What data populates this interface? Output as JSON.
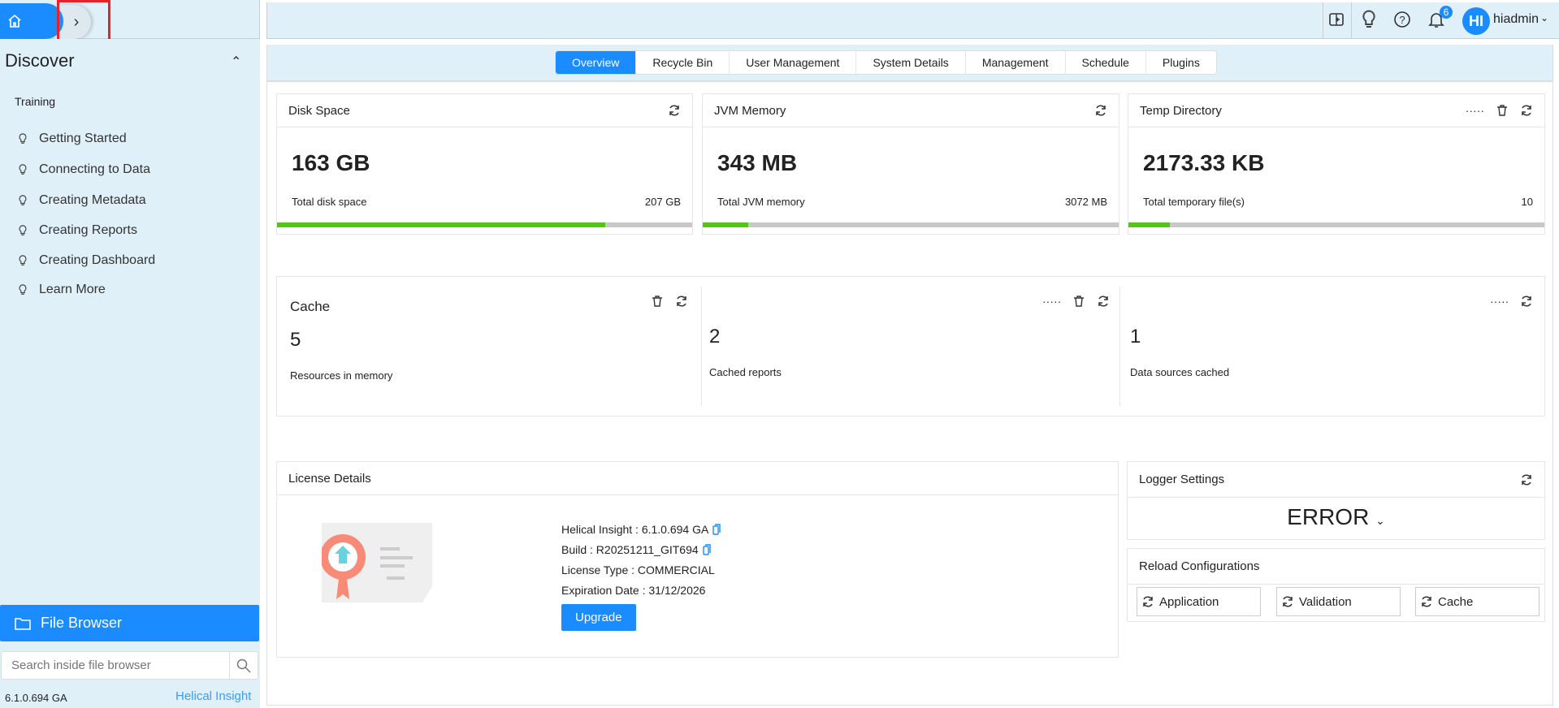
{
  "header": {
    "user_initials": "HI",
    "username": "hiadmin",
    "notification_count": "6"
  },
  "sidebar": {
    "title": "Discover",
    "section": "Training",
    "items": [
      {
        "label": "Getting Started"
      },
      {
        "label": "Connecting to Data"
      },
      {
        "label": "Creating Metadata"
      },
      {
        "label": "Creating Reports"
      },
      {
        "label": "Creating Dashboard"
      },
      {
        "label": "Learn More"
      }
    ],
    "file_browser": "File Browser",
    "search_placeholder": "Search inside file browser",
    "version": "6.1.0.694 GA",
    "brand": "Helical Insight"
  },
  "tabs": [
    {
      "label": "Overview",
      "active": true
    },
    {
      "label": "Recycle Bin"
    },
    {
      "label": "User Management"
    },
    {
      "label": "System Details"
    },
    {
      "label": "Management"
    },
    {
      "label": "Schedule"
    },
    {
      "label": "Plugins"
    }
  ],
  "cards": [
    {
      "title": "Disk Space",
      "value": "163 GB",
      "label": "Total disk space",
      "total": "207 GB",
      "progress": 0.79
    },
    {
      "title": "JVM Memory",
      "value": "343 MB",
      "label": "Total JVM memory",
      "total": "3072 MB",
      "progress": 0.11
    },
    {
      "title": "Temp Directory",
      "value": "2173.33 KB",
      "label": "Total temporary file(s)",
      "total": "10",
      "progress": 0.1
    }
  ],
  "cache": {
    "title": "Cache",
    "sections": [
      {
        "value": "5",
        "label": "Resources in memory"
      },
      {
        "value": "2",
        "label": "Cached reports"
      },
      {
        "value": "1",
        "label": "Data sources cached"
      }
    ]
  },
  "license": {
    "title": "License Details",
    "insight": "Helical Insight : 6.1.0.694 GA",
    "build": "Build : R20251211_GIT694",
    "type": "License Type : COMMERCIAL",
    "expiry": "Expiration Date : 31/12/2026",
    "upgrade": "Upgrade"
  },
  "logger": {
    "title": "Logger Settings",
    "level": "ERROR"
  },
  "reload": {
    "title": "Reload Configurations",
    "buttons": [
      "Application",
      "Validation",
      "Cache"
    ]
  },
  "colors": {
    "accent": "#1a8cff",
    "progress": "#52c41a",
    "sidebar_bg": "#e0f0f9"
  }
}
